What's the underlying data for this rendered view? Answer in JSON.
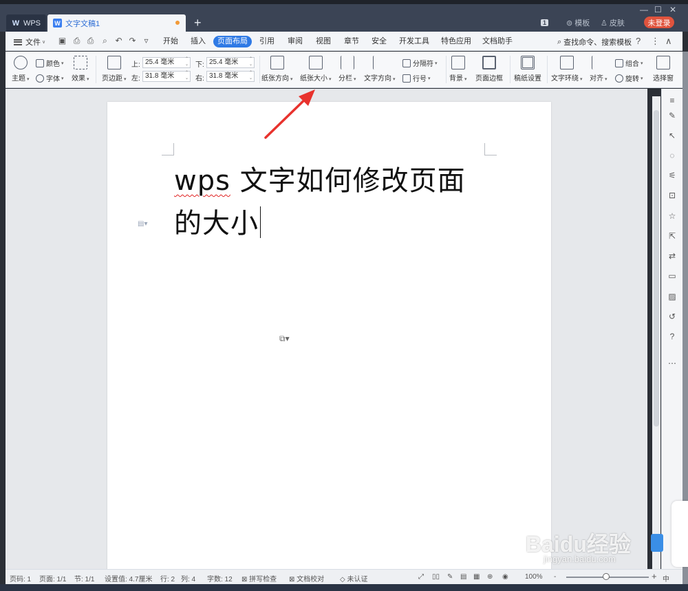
{
  "titlebar": {
    "wps_tab": "WPS",
    "doc_tab": "文字文稿1",
    "new_tab": "+",
    "badge": "1",
    "template": "模板",
    "skin": "皮肤",
    "login": "未登录"
  },
  "menubar": {
    "file": "文件",
    "items": [
      "开始",
      "插入",
      "页面布局",
      "引用",
      "审阅",
      "视图",
      "章节",
      "安全",
      "开发工具",
      "特色应用",
      "文档助手"
    ],
    "active": "页面布局",
    "search": "查找命令、搜索模板",
    "help": "?"
  },
  "ribbon": {
    "theme": "主题",
    "colors": "颜色",
    "fonts": "字体",
    "effects": "效果",
    "margins": "页边距",
    "top_label": "上:",
    "top_value": "25.4 毫米",
    "bottom_label": "下:",
    "bottom_value": "25.4 毫米",
    "left_label": "左:",
    "left_value": "31.8 毫米",
    "right_label": "右:",
    "right_value": "31.8 毫米",
    "orientation": "纸张方向",
    "size": "纸张大小",
    "columns": "分栏",
    "text_direction": "文字方向",
    "breaks": "分隔符",
    "line_numbers": "行号",
    "background": "背景",
    "page_border": "页面边框",
    "manuscript": "稿纸设置",
    "wrap": "文字环绕",
    "align": "对齐",
    "group": "组合",
    "rotate": "旋转",
    "selection_pane": "选择窗"
  },
  "document": {
    "line1_latin": "wps",
    "line1_cjk": " 文字如何修改页面",
    "line2": "的大小"
  },
  "statusbar": {
    "page_num": "页码: 1",
    "pages": "页面: 1/1",
    "section": "节: 1/1",
    "setting": "设置值: 4.7厘米",
    "row": "行: 2",
    "col": "列: 4",
    "words": "字数: 12",
    "spell": "拼写检查",
    "proof": "文档校对",
    "cert": "未认证",
    "zoom": "100%",
    "zoom_minus": "-",
    "zoom_plus": "+",
    "ime": "中"
  },
  "watermark": {
    "brand": "Baidu经验",
    "url": "jingyan.baidu.com"
  },
  "colors": {
    "accent": "#2f7ae5",
    "login": "#e0533d",
    "arrow": "#e8322d"
  }
}
